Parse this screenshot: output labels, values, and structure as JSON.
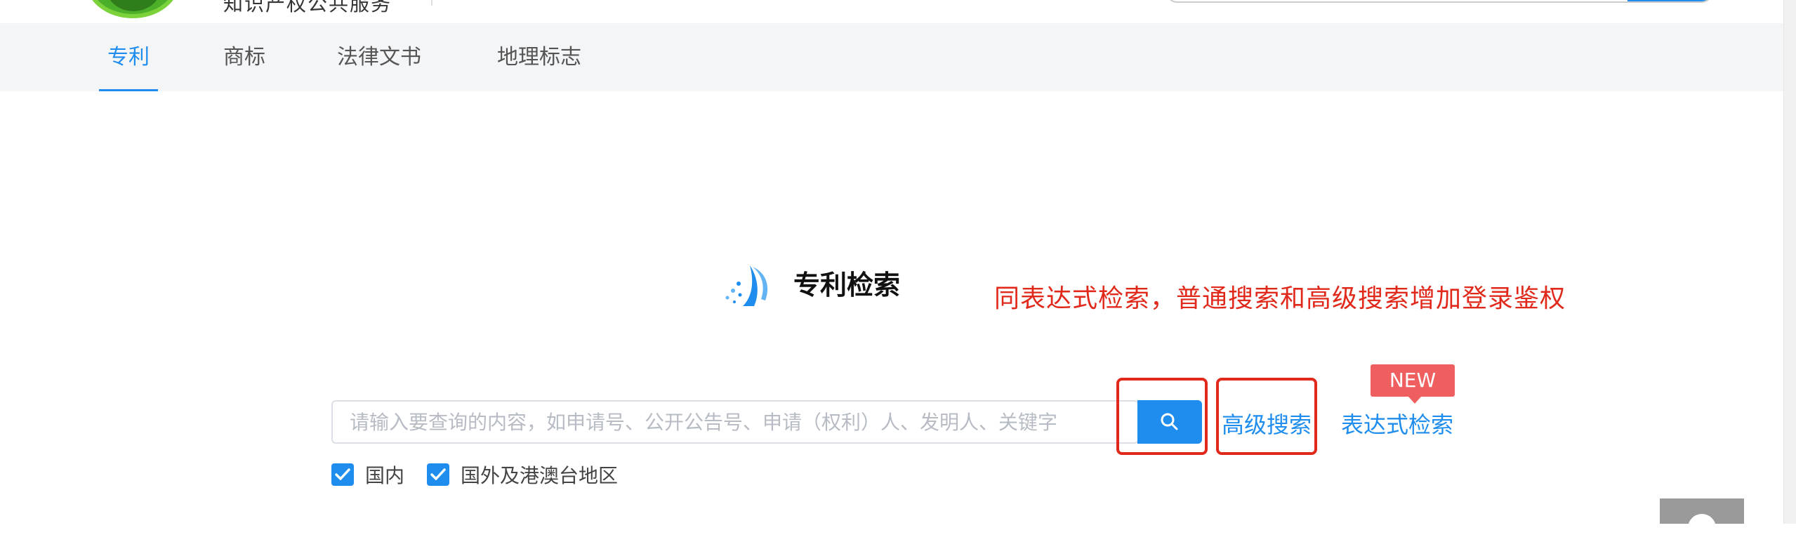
{
  "header": {
    "title_fragment": "知识产权公共服务"
  },
  "nav": {
    "items": [
      {
        "label": "专利",
        "active": true
      },
      {
        "label": "商标",
        "active": false
      },
      {
        "label": "法律文书",
        "active": false
      },
      {
        "label": "地理标志",
        "active": false
      }
    ]
  },
  "search": {
    "title": "专利检索",
    "placeholder": "请输入要查询的内容，如申请号、公开公告号、申请（权利）人、发明人、关键字",
    "search_icon": "search-icon",
    "advanced_label": "高级搜索",
    "expression_label": "表达式检索",
    "new_badge": "NEW",
    "filters": [
      {
        "label": "国内",
        "checked": true
      },
      {
        "label": "国外及港澳台地区",
        "checked": true
      }
    ]
  },
  "annotation": {
    "text": "同表达式检索，普通搜索和高级搜索增加登录鉴权",
    "color": "#e0291b"
  },
  "colors": {
    "accent": "#1f8ded",
    "nav_bg": "#f4f5f7",
    "badge": "#ef5f5f"
  }
}
